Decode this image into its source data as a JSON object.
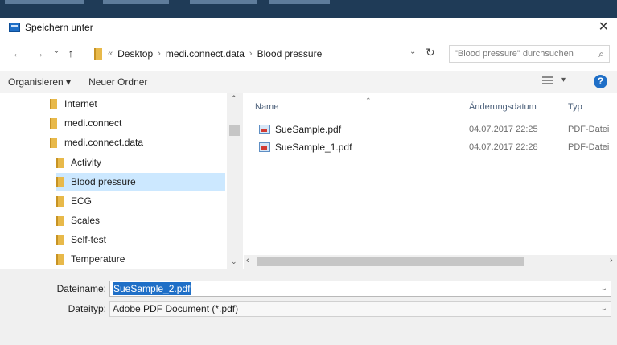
{
  "window": {
    "title": "Speichern unter",
    "close": "✕"
  },
  "nav": {
    "back": "←",
    "forward": "→",
    "dropdown": "⌄",
    "up": "↑",
    "refresh": "↻"
  },
  "breadcrumb": {
    "overflow": "«",
    "separator": "›",
    "items": [
      "Desktop",
      "medi.connect.data",
      "Blood pressure"
    ]
  },
  "search": {
    "placeholder": "\"Blood pressure\" durchsuchen",
    "icon": "⌕"
  },
  "toolbar": {
    "organize": "Organisieren ▾",
    "new_folder": "Neuer Ordner",
    "view_dropdown": "▾",
    "help": "?"
  },
  "sidebar": {
    "items": [
      {
        "label": "Internet",
        "level": 1,
        "selected": false
      },
      {
        "label": "medi.connect",
        "level": 1,
        "selected": false
      },
      {
        "label": "medi.connect.data",
        "level": 1,
        "selected": false
      },
      {
        "label": "Activity",
        "level": 2,
        "selected": false
      },
      {
        "label": "Blood pressure",
        "level": 2,
        "selected": true
      },
      {
        "label": "ECG",
        "level": 2,
        "selected": false
      },
      {
        "label": "Scales",
        "level": 2,
        "selected": false
      },
      {
        "label": "Self-test",
        "level": 2,
        "selected": false
      },
      {
        "label": "Temperature",
        "level": 2,
        "selected": false
      }
    ]
  },
  "scroll": {
    "up": "⌃",
    "down": "⌄",
    "left": "‹",
    "right": "›"
  },
  "files": {
    "columns": {
      "name": "Name",
      "date": "Änderungsdatum",
      "type": "Typ",
      "sort": "⌃"
    },
    "rows": [
      {
        "name": "SueSample.pdf",
        "date": "04.07.2017 22:25",
        "type": "PDF-Datei"
      },
      {
        "name": "SueSample_1.pdf",
        "date": "04.07.2017 22:28",
        "type": "PDF-Datei"
      }
    ]
  },
  "form": {
    "filename_label": "Dateiname:",
    "filename_value": "SueSample_2.pdf",
    "filetype_label": "Dateityp:",
    "filetype_value": "Adobe PDF Document (*.pdf)",
    "dropdown": "⌄"
  },
  "colors": {
    "accent": "#1f6fc7",
    "selection": "#cce8ff",
    "folder": "#e8b94a"
  }
}
